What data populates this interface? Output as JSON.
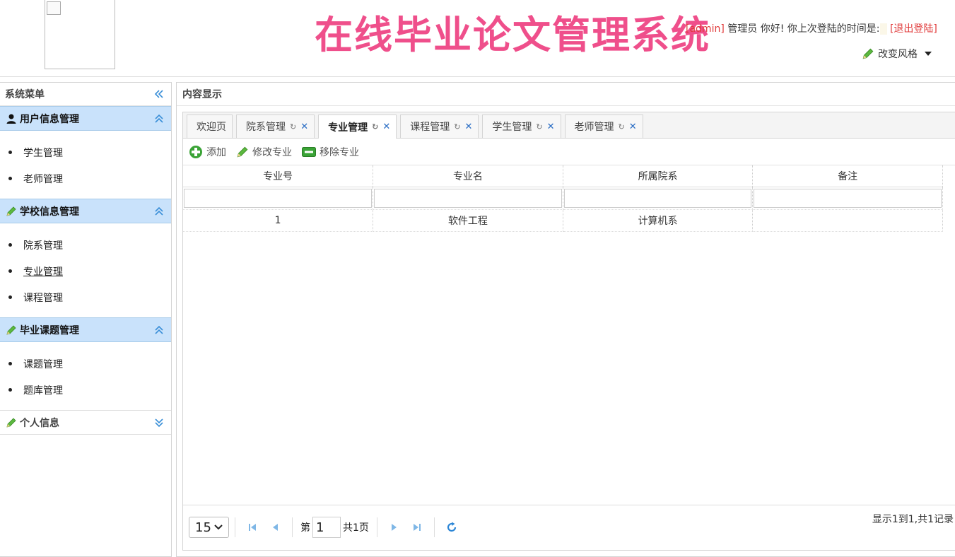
{
  "header": {
    "title": "在线毕业论文管理系统",
    "user_bracket_open": "[",
    "user_name": "admin",
    "user_bracket_close": "]",
    "greeting": "管理员 你好! 你上次登陆的时间是:",
    "logout": "[退出登陆]",
    "change_style": "改变风格"
  },
  "sidebar": {
    "title": "系统菜单",
    "panels": [
      {
        "title": "用户信息管理",
        "items": [
          "学生管理",
          "老师管理"
        ]
      },
      {
        "title": "学校信息管理",
        "items": [
          "院系管理",
          "专业管理",
          "课程管理"
        ]
      },
      {
        "title": "毕业课题管理",
        "items": [
          "课题管理",
          "题库管理"
        ]
      },
      {
        "title": "个人信息",
        "items": []
      }
    ]
  },
  "content": {
    "title": "内容显示",
    "tabs": [
      "欢迎页",
      "院系管理",
      "专业管理",
      "课程管理",
      "学生管理",
      "老师管理"
    ],
    "active_tab": "专业管理",
    "toolbar": {
      "add": "添加",
      "edit": "修改专业",
      "remove": "移除专业"
    },
    "table": {
      "columns": [
        "专业号",
        "专业名",
        "所属院系",
        "备注"
      ],
      "rows": [
        [
          "1",
          "软件工程",
          "计算机系",
          ""
        ]
      ]
    },
    "pager": {
      "page_size": "15",
      "page_prefix": "第",
      "page_number": "1",
      "page_total": "共1页",
      "summary": "显示1到1,共1记录"
    }
  },
  "colors": {
    "title": "#ef4f8b",
    "accent": "#c9e2fb",
    "link_red": "#e03a3a"
  }
}
